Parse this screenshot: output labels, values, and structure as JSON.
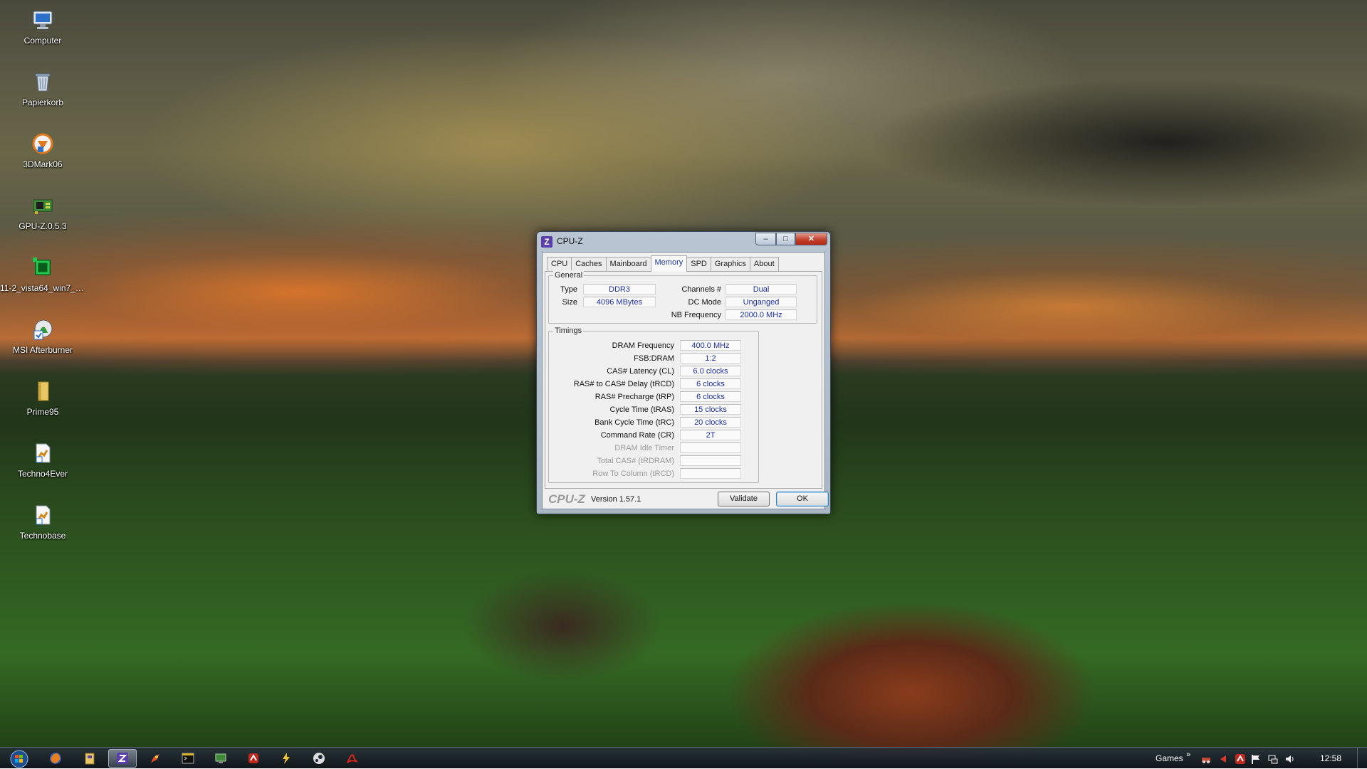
{
  "desktop": {
    "icons": [
      {
        "label": "Computer",
        "icon": "computer-icon"
      },
      {
        "label": "Papierkorb",
        "icon": "recycle-bin-icon"
      },
      {
        "label": "3DMark06",
        "icon": "3dmark-icon"
      },
      {
        "label": "GPU-Z.0.5.3",
        "icon": "gpu-z-icon"
      },
      {
        "label": "11-2_vista64_win7_6...",
        "icon": "ati-driver-icon"
      },
      {
        "label": "MSI Afterburner",
        "icon": "afterburner-icon"
      },
      {
        "label": "Prime95",
        "icon": "folder-icon"
      },
      {
        "label": "Techno4Ever",
        "icon": "shortcut-icon"
      },
      {
        "label": "Technobase",
        "icon": "shortcut-icon"
      }
    ]
  },
  "window": {
    "title": "CPU-Z",
    "icon_letter": "Z",
    "controls": {
      "minimize": "–",
      "maximize": "□",
      "close": "✕"
    },
    "tabs": [
      "CPU",
      "Caches",
      "Mainboard",
      "Memory",
      "SPD",
      "Graphics",
      "About"
    ],
    "active_tab": "Memory",
    "general": {
      "legend": "General",
      "type_label": "Type",
      "type_value": "DDR3",
      "size_label": "Size",
      "size_value": "4096 MBytes",
      "channels_label": "Channels #",
      "channels_value": "Dual",
      "dcmode_label": "DC Mode",
      "dcmode_value": "Unganged",
      "nbfreq_label": "NB Frequency",
      "nbfreq_value": "2000.0 MHz"
    },
    "timings": {
      "legend": "Timings",
      "rows": [
        {
          "label": "DRAM Frequency",
          "value": "400.0 MHz"
        },
        {
          "label": "FSB:DRAM",
          "value": "1:2"
        },
        {
          "label": "CAS# Latency (CL)",
          "value": "6.0 clocks"
        },
        {
          "label": "RAS# to CAS# Delay (tRCD)",
          "value": "6 clocks"
        },
        {
          "label": "RAS# Precharge (tRP)",
          "value": "6 clocks"
        },
        {
          "label": "Cycle Time (tRAS)",
          "value": "15 clocks"
        },
        {
          "label": "Bank Cycle Time (tRC)",
          "value": "20 clocks"
        },
        {
          "label": "Command Rate (CR)",
          "value": "2T"
        },
        {
          "label": "DRAM Idle Timer",
          "value": ""
        },
        {
          "label": "Total CAS# (tRDRAM)",
          "value": ""
        },
        {
          "label": "Row To Column (tRCD)",
          "value": ""
        }
      ]
    },
    "brand": "CPU-Z",
    "version": "Version 1.57.1",
    "validate_label": "Validate",
    "ok_label": "OK"
  },
  "taskbar": {
    "toolbar_label": "Games",
    "toolbar_chevron": "»",
    "clock": "12:58",
    "pinned": [
      "firefox-icon",
      "explorer-icon",
      "cpu-z-icon",
      "rocket-icon",
      "terminal-icon",
      "monitor-icon",
      "antivirus-icon",
      "lightning-icon",
      "steam-icon",
      "acrobat-icon"
    ],
    "tray": [
      "network-tool-icon",
      "arrow-icon",
      "antivirus-tray-icon",
      "flag-icon",
      "network-icon",
      "volume-icon"
    ]
  },
  "colors": {
    "value_text": "#1c2fa0",
    "active_tab_text": "#1f3e9a",
    "close_button": "#c2402c"
  }
}
